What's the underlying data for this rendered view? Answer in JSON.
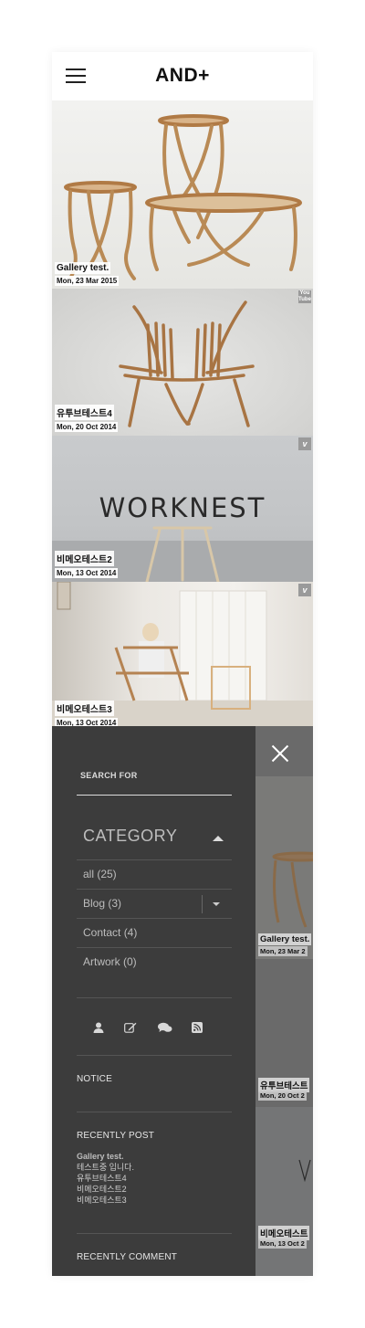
{
  "header": {
    "logo": "AND+"
  },
  "posts": [
    {
      "title": "Gallery test.",
      "date": "Mon, 23 Mar 2015",
      "badge": ""
    },
    {
      "title": "유투브테스트4",
      "date": "Mon, 20 Oct 2014",
      "badge": "You Tube"
    },
    {
      "title": "비메오테스트2",
      "date": "Mon, 13 Oct 2014",
      "badge": "v"
    },
    {
      "title": "비메오테스트3",
      "date": "Mon, 13 Oct 2014",
      "badge": "v"
    }
  ],
  "worknest_text": "WORKNEST",
  "drawer": {
    "search_label": "SEARCH FOR",
    "category_title": "CATEGORY",
    "categories": [
      {
        "label": "all (25)"
      },
      {
        "label": "Blog (3)"
      },
      {
        "label": "Contact (4)"
      },
      {
        "label": "Artwork (0)"
      }
    ],
    "icons": [
      "user-icon",
      "edit-icon",
      "comments-icon",
      "rss-icon"
    ],
    "notice_title": "NOTICE",
    "recent_post_title": "RECENTLY POST",
    "recent_posts": [
      "Gallery test.",
      "테스트중 입니다.",
      "유투브테스트4",
      "비메오테스트2",
      "비메오테스트3"
    ],
    "recent_comment_title": "RECENTLY COMMENT"
  },
  "peek": [
    {
      "title": "Gallery test.",
      "date": "Mon, 23 Mar 2"
    },
    {
      "title": "유투브테스트",
      "date": "Mon, 20 Oct 2"
    },
    {
      "title": "비메오테스트",
      "date": "Mon, 13 Oct 2"
    }
  ]
}
